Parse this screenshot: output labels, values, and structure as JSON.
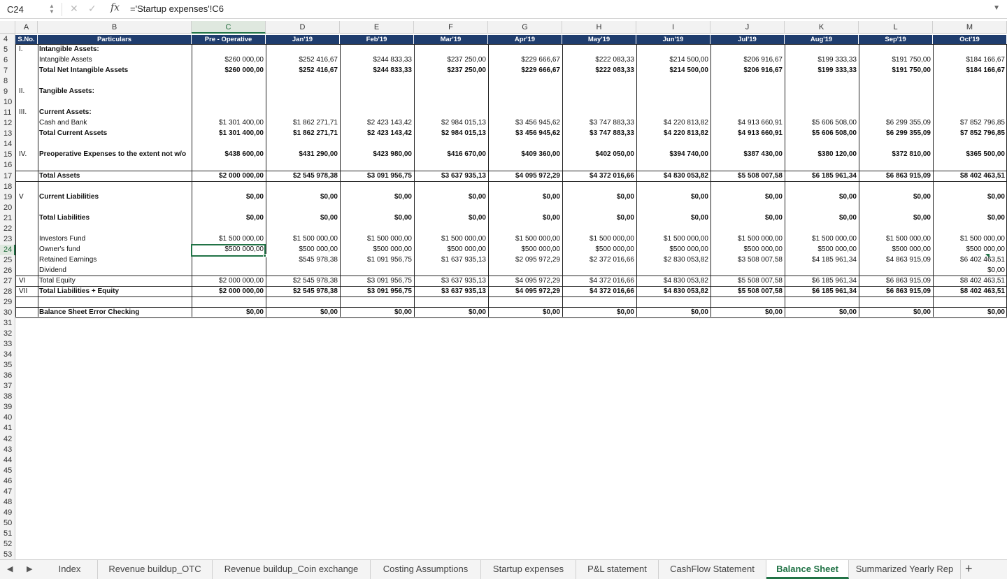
{
  "formula_bar": {
    "cell_ref": "C24",
    "formula": "='Startup expenses'!C6",
    "fx_label": "fx"
  },
  "columns": [
    "A",
    "B",
    "C",
    "D",
    "E",
    "F",
    "G",
    "H",
    "I",
    "J",
    "K",
    "L",
    "M"
  ],
  "rows": [
    "4",
    "5",
    "6",
    "7",
    "8",
    "9",
    "10",
    "11",
    "12",
    "13",
    "14",
    "15",
    "16",
    "17",
    "18",
    "19",
    "20",
    "21",
    "22",
    "23",
    "24",
    "25",
    "26",
    "27",
    "28",
    "29",
    "30",
    "31",
    "32",
    "33",
    "34",
    "35",
    "36",
    "37",
    "38",
    "39",
    "40",
    "41",
    "42",
    "43",
    "44",
    "45",
    "46",
    "47",
    "48",
    "49",
    "50",
    "51",
    "52",
    "53"
  ],
  "sheet": {
    "headers": [
      "S.No.",
      "Particulars",
      "Pre - Operative",
      "Jan'19",
      "Feb'19",
      "Mar'19",
      "Apr'19",
      "May'19",
      "Jun'19",
      "Jul'19",
      "Aug'19",
      "Sep'19",
      "Oct'19"
    ],
    "lines": [
      {
        "row": "5",
        "sno": "I.",
        "label": "Intangible Assets:",
        "bold": true,
        "values": []
      },
      {
        "row": "6",
        "sno": "",
        "label": "Intangible Assets",
        "bold": false,
        "values": [
          "$260 000,00",
          "$252 416,67",
          "$244 833,33",
          "$237 250,00",
          "$229 666,67",
          "$222 083,33",
          "$214 500,00",
          "$206 916,67",
          "$199 333,33",
          "$191 750,00",
          "$184 166,67"
        ]
      },
      {
        "row": "7",
        "sno": "",
        "label": "Total Net Intangible Assets",
        "bold": true,
        "values": [
          "$260 000,00",
          "$252 416,67",
          "$244 833,33",
          "$237 250,00",
          "$229 666,67",
          "$222 083,33",
          "$214 500,00",
          "$206 916,67",
          "$199 333,33",
          "$191 750,00",
          "$184 166,67"
        ]
      },
      {
        "row": "9",
        "sno": "II.",
        "label": "Tangible Assets:",
        "bold": true,
        "values": []
      },
      {
        "row": "11",
        "sno": "III.",
        "label": "Current Assets:",
        "bold": true,
        "values": []
      },
      {
        "row": "12",
        "sno": "",
        "label": "Cash and Bank",
        "bold": false,
        "values": [
          "$1 301 400,00",
          "$1 862 271,71",
          "$2 423 143,42",
          "$2 984 015,13",
          "$3 456 945,62",
          "$3 747 883,33",
          "$4 220 813,82",
          "$4 913 660,91",
          "$5 606 508,00",
          "$6 299 355,09",
          "$7 852 796,85"
        ]
      },
      {
        "row": "13",
        "sno": "",
        "label": "Total Current Assets",
        "bold": true,
        "values": [
          "$1 301 400,00",
          "$1 862 271,71",
          "$2 423 143,42",
          "$2 984 015,13",
          "$3 456 945,62",
          "$3 747 883,33",
          "$4 220 813,82",
          "$4 913 660,91",
          "$5 606 508,00",
          "$6 299 355,09",
          "$7 852 796,85"
        ]
      },
      {
        "row": "15",
        "sno": "IV.",
        "label": "Preoperative Expenses to the extent not w/o",
        "bold": true,
        "values": [
          "$438 600,00",
          "$431 290,00",
          "$423 980,00",
          "$416 670,00",
          "$409 360,00",
          "$402 050,00",
          "$394 740,00",
          "$387 430,00",
          "$380 120,00",
          "$372 810,00",
          "$365 500,00"
        ]
      },
      {
        "row": "17",
        "sno": "",
        "label": "Total Assets",
        "bold": true,
        "values": [
          "$2 000 000,00",
          "$2 545 978,38",
          "$3 091 956,75",
          "$3 637 935,13",
          "$4 095 972,29",
          "$4 372 016,66",
          "$4 830 053,82",
          "$5 508 007,58",
          "$6 185 961,34",
          "$6 863 915,09",
          "$8 402 463,51"
        ]
      },
      {
        "row": "19",
        "sno": "V",
        "label": "Current Liabilities",
        "bold": true,
        "values": [
          "$0,00",
          "$0,00",
          "$0,00",
          "$0,00",
          "$0,00",
          "$0,00",
          "$0,00",
          "$0,00",
          "$0,00",
          "$0,00",
          "$0,00"
        ]
      },
      {
        "row": "21",
        "sno": "",
        "label": "Total Liabilities",
        "bold": true,
        "values": [
          "$0,00",
          "$0,00",
          "$0,00",
          "$0,00",
          "$0,00",
          "$0,00",
          "$0,00",
          "$0,00",
          "$0,00",
          "$0,00",
          "$0,00"
        ]
      },
      {
        "row": "23",
        "sno": "",
        "label": "Investors Fund",
        "bold": false,
        "values": [
          "$1 500 000,00",
          "$1 500 000,00",
          "$1 500 000,00",
          "$1 500 000,00",
          "$1 500 000,00",
          "$1 500 000,00",
          "$1 500 000,00",
          "$1 500 000,00",
          "$1 500 000,00",
          "$1 500 000,00",
          "$1 500 000,00"
        ]
      },
      {
        "row": "24",
        "sno": "",
        "label": "Owner's fund",
        "bold": false,
        "values": [
          "$500 000,00",
          "$500 000,00",
          "$500 000,00",
          "$500 000,00",
          "$500 000,00",
          "$500 000,00",
          "$500 000,00",
          "$500 000,00",
          "$500 000,00",
          "$500 000,00",
          "$500 000,00"
        ]
      },
      {
        "row": "25",
        "sno": "",
        "label": "Retained Earnings",
        "bold": false,
        "values": [
          "",
          "$545 978,38",
          "$1 091 956,75",
          "$1 637 935,13",
          "$2 095 972,29",
          "$2 372 016,66",
          "$2 830 053,82",
          "$3 508 007,58",
          "$4 185 961,34",
          "$4 863 915,09",
          "$6 402 463,51"
        ]
      },
      {
        "row": "26",
        "sno": "",
        "label": "Dividend",
        "bold": false,
        "values": [
          "",
          "",
          "",
          "",
          "",
          "",
          "",
          "",
          "",
          "",
          "$0,00"
        ]
      },
      {
        "row": "27",
        "sno": "VI",
        "label": "Total Equity",
        "bold": false,
        "values": [
          "$2 000 000,00",
          "$2 545 978,38",
          "$3 091 956,75",
          "$3 637 935,13",
          "$4 095 972,29",
          "$4 372 016,66",
          "$4 830 053,82",
          "$5 508 007,58",
          "$6 185 961,34",
          "$6 863 915,09",
          "$8 402 463,51"
        ]
      },
      {
        "row": "28",
        "sno": "VII",
        "label": "Total Liabilities + Equity",
        "bold": true,
        "values": [
          "$2 000 000,00",
          "$2 545 978,38",
          "$3 091 956,75",
          "$3 637 935,13",
          "$4 095 972,29",
          "$4 372 016,66",
          "$4 830 053,82",
          "$5 508 007,58",
          "$6 185 961,34",
          "$6 863 915,09",
          "$8 402 463,51"
        ]
      },
      {
        "row": "30",
        "sno": "",
        "label": "Balance Sheet Error Checking",
        "bold": true,
        "values": [
          "$0,00",
          "$0,00",
          "$0,00",
          "$0,00",
          "$0,00",
          "$0,00",
          "$0,00",
          "$0,00",
          "$0,00",
          "$0,00",
          "$0,00"
        ]
      }
    ]
  },
  "tabs": {
    "items": [
      "Index",
      "Revenue buildup_OTC",
      "Revenue buildup_Coin exchange",
      "Costing Assumptions",
      "Startup expenses",
      "P&L statement",
      "CashFlow Statement",
      "Balance Sheet",
      "Summarized Yearly Rep"
    ],
    "active": "Balance Sheet",
    "add_label": "+"
  },
  "colors": {
    "header_band": "#1f3d6e",
    "accent": "#217346"
  }
}
